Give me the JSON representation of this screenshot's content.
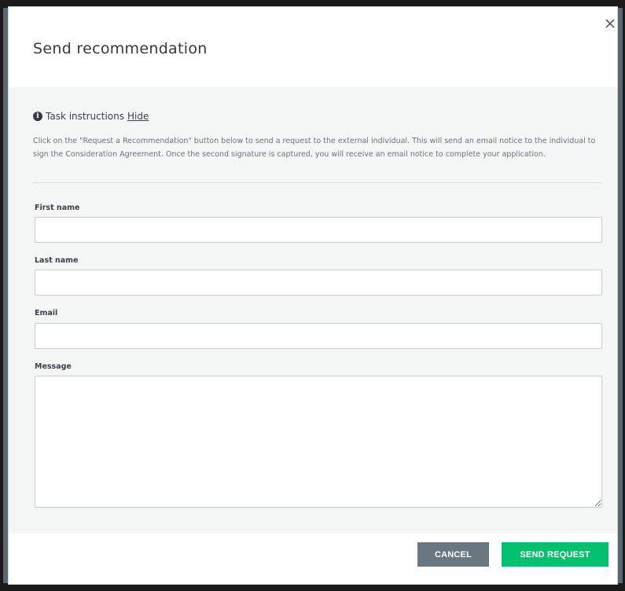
{
  "modal": {
    "title": "Send recommendation",
    "close_icon": "close-icon"
  },
  "instructions": {
    "icon": "info-icon",
    "icon_glyph": "i",
    "heading": "Task instructions",
    "hide_link": "Hide",
    "text": "Click on the \"Request a Recommendation\" button below to send a request to the external individual. This will send an email notice to the individual to sign the Consideration Agreement. Once the second signature is captured, you will receive an email notice to complete your application."
  },
  "form": {
    "first_name": {
      "label": "First name",
      "value": "",
      "placeholder": ""
    },
    "last_name": {
      "label": "Last name",
      "value": "",
      "placeholder": ""
    },
    "email": {
      "label": "Email",
      "value": "",
      "placeholder": ""
    },
    "message": {
      "label": "Message",
      "value": "",
      "placeholder": ""
    }
  },
  "footer": {
    "cancel_label": "CANCEL",
    "send_label": "SEND REQUEST"
  },
  "colors": {
    "send_button": "#00bf6f",
    "cancel_button": "#6b7780",
    "body_background": "#f4f5f5"
  }
}
